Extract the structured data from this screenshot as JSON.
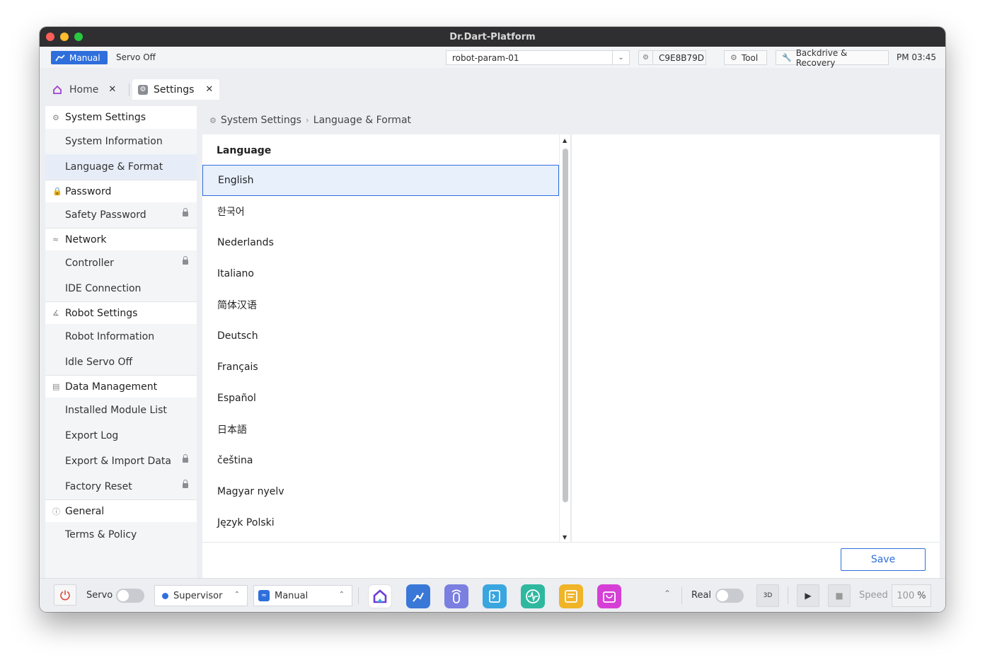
{
  "window": {
    "title": "Dr.Dart-Platform"
  },
  "topbar": {
    "mode_label": "Manual",
    "servo_status": "Servo Off",
    "param_value": "robot-param-01",
    "serial": "C9E8B79D",
    "tool_label": "Tool",
    "backdrive_label": "Backdrive & Recovery",
    "clock": "PM 03:45"
  },
  "tabs": [
    {
      "label": "Home"
    },
    {
      "label": "Settings"
    }
  ],
  "sidebar": {
    "groups": [
      {
        "label": "System Settings",
        "icon": "gear-icon",
        "items": [
          "System Information",
          "Language & Format"
        ]
      },
      {
        "label": "Password",
        "icon": "lock-icon",
        "items": [
          "Safety Password"
        ]
      },
      {
        "label": "Network",
        "icon": "wifi-icon",
        "items": [
          "Controller",
          "IDE Connection"
        ]
      },
      {
        "label": "Robot Settings",
        "icon": "robot-arm-icon",
        "items": [
          "Robot Information",
          "Idle Servo Off"
        ]
      },
      {
        "label": "Data Management",
        "icon": "document-icon",
        "items": [
          "Installed Module List",
          "Export Log",
          "Export & Import Data",
          "Factory Reset"
        ]
      },
      {
        "label": "General",
        "icon": "info-icon",
        "items": [
          "Terms & Policy"
        ]
      }
    ],
    "active_item": "Language & Format",
    "locked_items": [
      "Safety Password",
      "Controller",
      "Export & Import Data",
      "Factory Reset"
    ]
  },
  "breadcrumb": {
    "root": "System Settings",
    "current": "Language & Format"
  },
  "language": {
    "title": "Language",
    "options": [
      "English",
      "한국어",
      "Nederlands",
      "Italiano",
      "简体汉语",
      "Deutsch",
      "Français",
      "Español",
      "日本語",
      "čeština",
      "Magyar nyelv",
      "Język Polski"
    ],
    "selected": "English"
  },
  "save_label": "Save",
  "bottombar": {
    "servo_label": "Servo",
    "role_value": "Supervisor",
    "mode_value": "Manual",
    "real_label": "Real",
    "speed_label": "Speed",
    "speed_value": "100",
    "speed_unit": "%",
    "apps": [
      {
        "name": "home-app-icon",
        "color": "#ffffff"
      },
      {
        "name": "robot-app-icon",
        "color": "#3a78d8"
      },
      {
        "name": "remote-app-icon",
        "color": "#7b7fe0"
      },
      {
        "name": "task-app-icon",
        "color": "#3aa6e0"
      },
      {
        "name": "monitor-app-icon",
        "color": "#2fb8a0"
      },
      {
        "name": "notes-app-icon",
        "color": "#f0b429"
      },
      {
        "name": "store-app-icon",
        "color": "#d63fd6"
      }
    ]
  },
  "colors": {
    "accent": "#2f6fdc",
    "selected_bg": "#e8f0fc"
  }
}
